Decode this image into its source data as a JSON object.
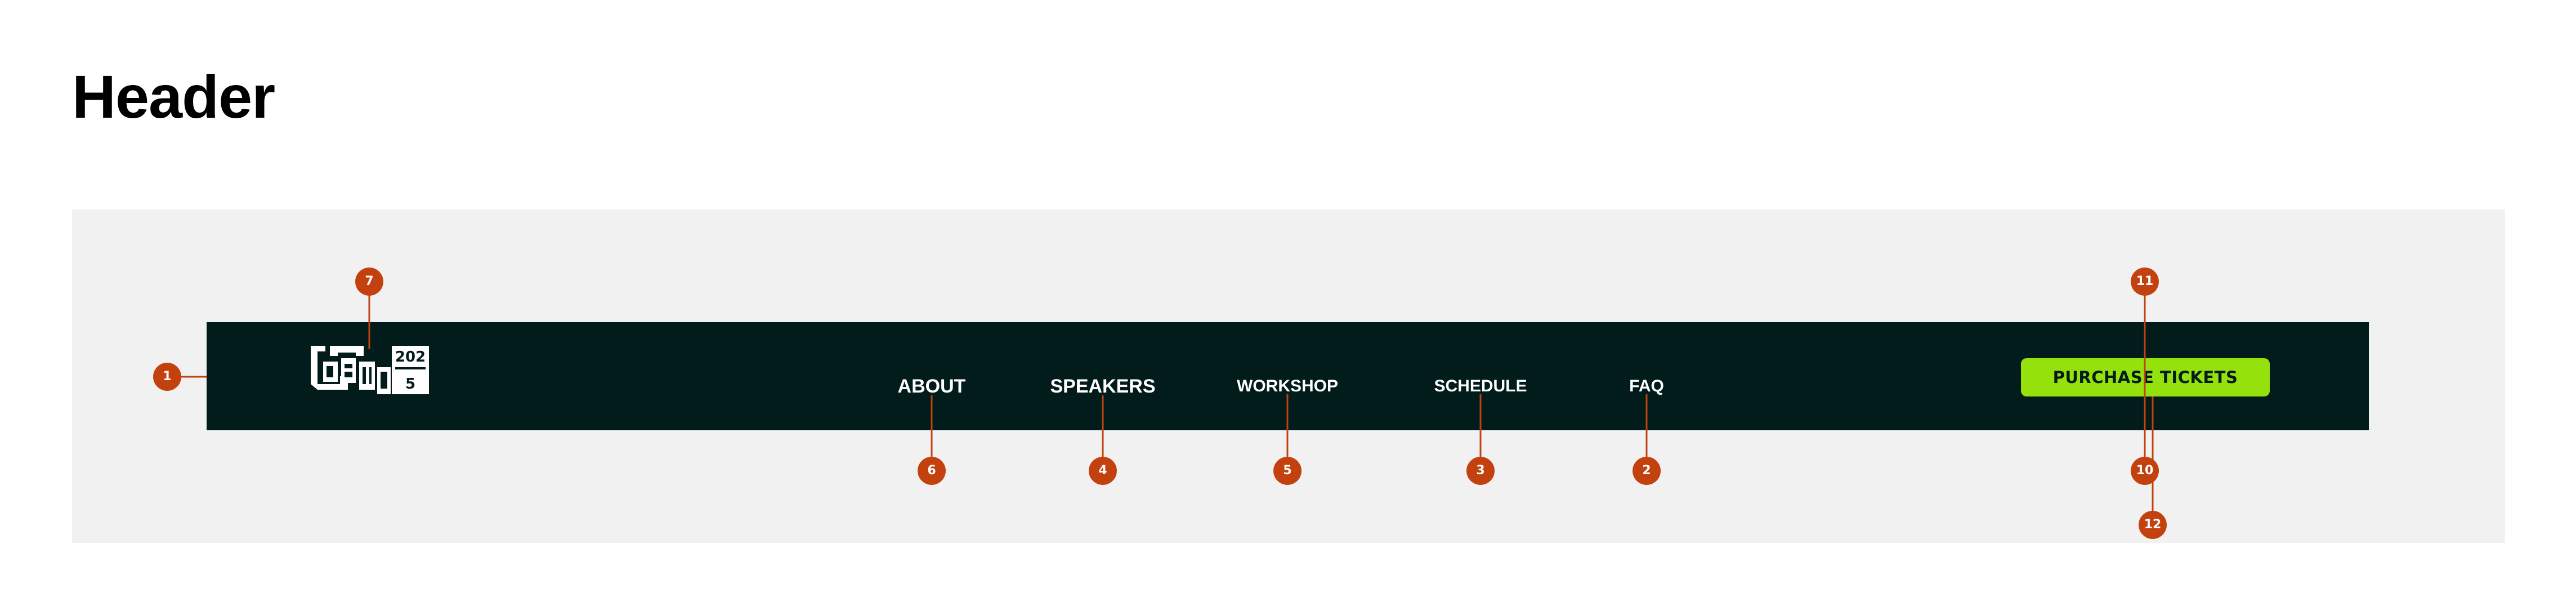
{
  "page": {
    "title": "Header"
  },
  "header": {
    "logo": {
      "icon": "gen-logo-icon"
    },
    "nav": [
      {
        "id": "about",
        "label": "ABOUT"
      },
      {
        "id": "speakers",
        "label": "SPEAKERS"
      },
      {
        "id": "workshop",
        "label": "WORKSHOP"
      },
      {
        "id": "schedule",
        "label": "SCHEDULE"
      },
      {
        "id": "faq",
        "label": "FAQ"
      }
    ],
    "cta": {
      "label": "PURCHASE TICKETS"
    }
  },
  "markers": [
    {
      "id": "m1",
      "label": "1"
    },
    {
      "id": "m2",
      "label": "2"
    },
    {
      "id": "m3",
      "label": "3"
    },
    {
      "id": "m4",
      "label": "4"
    },
    {
      "id": "m5",
      "label": "5"
    },
    {
      "id": "m6",
      "label": "6"
    },
    {
      "id": "m7",
      "label": "7"
    },
    {
      "id": "m10",
      "label": "10"
    },
    {
      "id": "m11",
      "label": "11"
    },
    {
      "id": "m12",
      "label": "12"
    }
  ],
  "colors": {
    "header_bg": "#021c1b",
    "accent": "#94e10c",
    "marker": "#c3410e",
    "canvas_bg": "#f1f1f1"
  }
}
